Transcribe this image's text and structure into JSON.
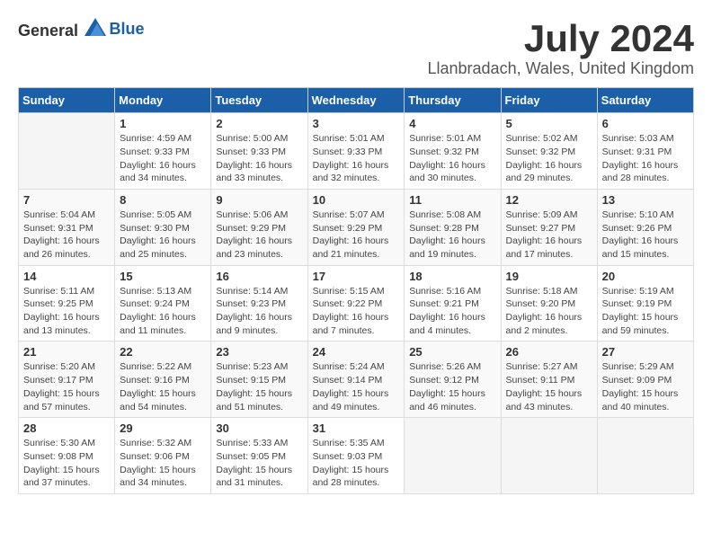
{
  "header": {
    "logo_general": "General",
    "logo_blue": "Blue",
    "title": "July 2024",
    "subtitle": "Llanbradach, Wales, United Kingdom"
  },
  "calendar": {
    "days_of_week": [
      "Sunday",
      "Monday",
      "Tuesday",
      "Wednesday",
      "Thursday",
      "Friday",
      "Saturday"
    ],
    "weeks": [
      [
        {
          "day": "",
          "info": ""
        },
        {
          "day": "1",
          "info": "Sunrise: 4:59 AM\nSunset: 9:33 PM\nDaylight: 16 hours\nand 34 minutes."
        },
        {
          "day": "2",
          "info": "Sunrise: 5:00 AM\nSunset: 9:33 PM\nDaylight: 16 hours\nand 33 minutes."
        },
        {
          "day": "3",
          "info": "Sunrise: 5:01 AM\nSunset: 9:33 PM\nDaylight: 16 hours\nand 32 minutes."
        },
        {
          "day": "4",
          "info": "Sunrise: 5:01 AM\nSunset: 9:32 PM\nDaylight: 16 hours\nand 30 minutes."
        },
        {
          "day": "5",
          "info": "Sunrise: 5:02 AM\nSunset: 9:32 PM\nDaylight: 16 hours\nand 29 minutes."
        },
        {
          "day": "6",
          "info": "Sunrise: 5:03 AM\nSunset: 9:31 PM\nDaylight: 16 hours\nand 28 minutes."
        }
      ],
      [
        {
          "day": "7",
          "info": "Sunrise: 5:04 AM\nSunset: 9:31 PM\nDaylight: 16 hours\nand 26 minutes."
        },
        {
          "day": "8",
          "info": "Sunrise: 5:05 AM\nSunset: 9:30 PM\nDaylight: 16 hours\nand 25 minutes."
        },
        {
          "day": "9",
          "info": "Sunrise: 5:06 AM\nSunset: 9:29 PM\nDaylight: 16 hours\nand 23 minutes."
        },
        {
          "day": "10",
          "info": "Sunrise: 5:07 AM\nSunset: 9:29 PM\nDaylight: 16 hours\nand 21 minutes."
        },
        {
          "day": "11",
          "info": "Sunrise: 5:08 AM\nSunset: 9:28 PM\nDaylight: 16 hours\nand 19 minutes."
        },
        {
          "day": "12",
          "info": "Sunrise: 5:09 AM\nSunset: 9:27 PM\nDaylight: 16 hours\nand 17 minutes."
        },
        {
          "day": "13",
          "info": "Sunrise: 5:10 AM\nSunset: 9:26 PM\nDaylight: 16 hours\nand 15 minutes."
        }
      ],
      [
        {
          "day": "14",
          "info": "Sunrise: 5:11 AM\nSunset: 9:25 PM\nDaylight: 16 hours\nand 13 minutes."
        },
        {
          "day": "15",
          "info": "Sunrise: 5:13 AM\nSunset: 9:24 PM\nDaylight: 16 hours\nand 11 minutes."
        },
        {
          "day": "16",
          "info": "Sunrise: 5:14 AM\nSunset: 9:23 PM\nDaylight: 16 hours\nand 9 minutes."
        },
        {
          "day": "17",
          "info": "Sunrise: 5:15 AM\nSunset: 9:22 PM\nDaylight: 16 hours\nand 7 minutes."
        },
        {
          "day": "18",
          "info": "Sunrise: 5:16 AM\nSunset: 9:21 PM\nDaylight: 16 hours\nand 4 minutes."
        },
        {
          "day": "19",
          "info": "Sunrise: 5:18 AM\nSunset: 9:20 PM\nDaylight: 16 hours\nand 2 minutes."
        },
        {
          "day": "20",
          "info": "Sunrise: 5:19 AM\nSunset: 9:19 PM\nDaylight: 15 hours\nand 59 minutes."
        }
      ],
      [
        {
          "day": "21",
          "info": "Sunrise: 5:20 AM\nSunset: 9:17 PM\nDaylight: 15 hours\nand 57 minutes."
        },
        {
          "day": "22",
          "info": "Sunrise: 5:22 AM\nSunset: 9:16 PM\nDaylight: 15 hours\nand 54 minutes."
        },
        {
          "day": "23",
          "info": "Sunrise: 5:23 AM\nSunset: 9:15 PM\nDaylight: 15 hours\nand 51 minutes."
        },
        {
          "day": "24",
          "info": "Sunrise: 5:24 AM\nSunset: 9:14 PM\nDaylight: 15 hours\nand 49 minutes."
        },
        {
          "day": "25",
          "info": "Sunrise: 5:26 AM\nSunset: 9:12 PM\nDaylight: 15 hours\nand 46 minutes."
        },
        {
          "day": "26",
          "info": "Sunrise: 5:27 AM\nSunset: 9:11 PM\nDaylight: 15 hours\nand 43 minutes."
        },
        {
          "day": "27",
          "info": "Sunrise: 5:29 AM\nSunset: 9:09 PM\nDaylight: 15 hours\nand 40 minutes."
        }
      ],
      [
        {
          "day": "28",
          "info": "Sunrise: 5:30 AM\nSunset: 9:08 PM\nDaylight: 15 hours\nand 37 minutes."
        },
        {
          "day": "29",
          "info": "Sunrise: 5:32 AM\nSunset: 9:06 PM\nDaylight: 15 hours\nand 34 minutes."
        },
        {
          "day": "30",
          "info": "Sunrise: 5:33 AM\nSunset: 9:05 PM\nDaylight: 15 hours\nand 31 minutes."
        },
        {
          "day": "31",
          "info": "Sunrise: 5:35 AM\nSunset: 9:03 PM\nDaylight: 15 hours\nand 28 minutes."
        },
        {
          "day": "",
          "info": ""
        },
        {
          "day": "",
          "info": ""
        },
        {
          "day": "",
          "info": ""
        }
      ]
    ]
  }
}
